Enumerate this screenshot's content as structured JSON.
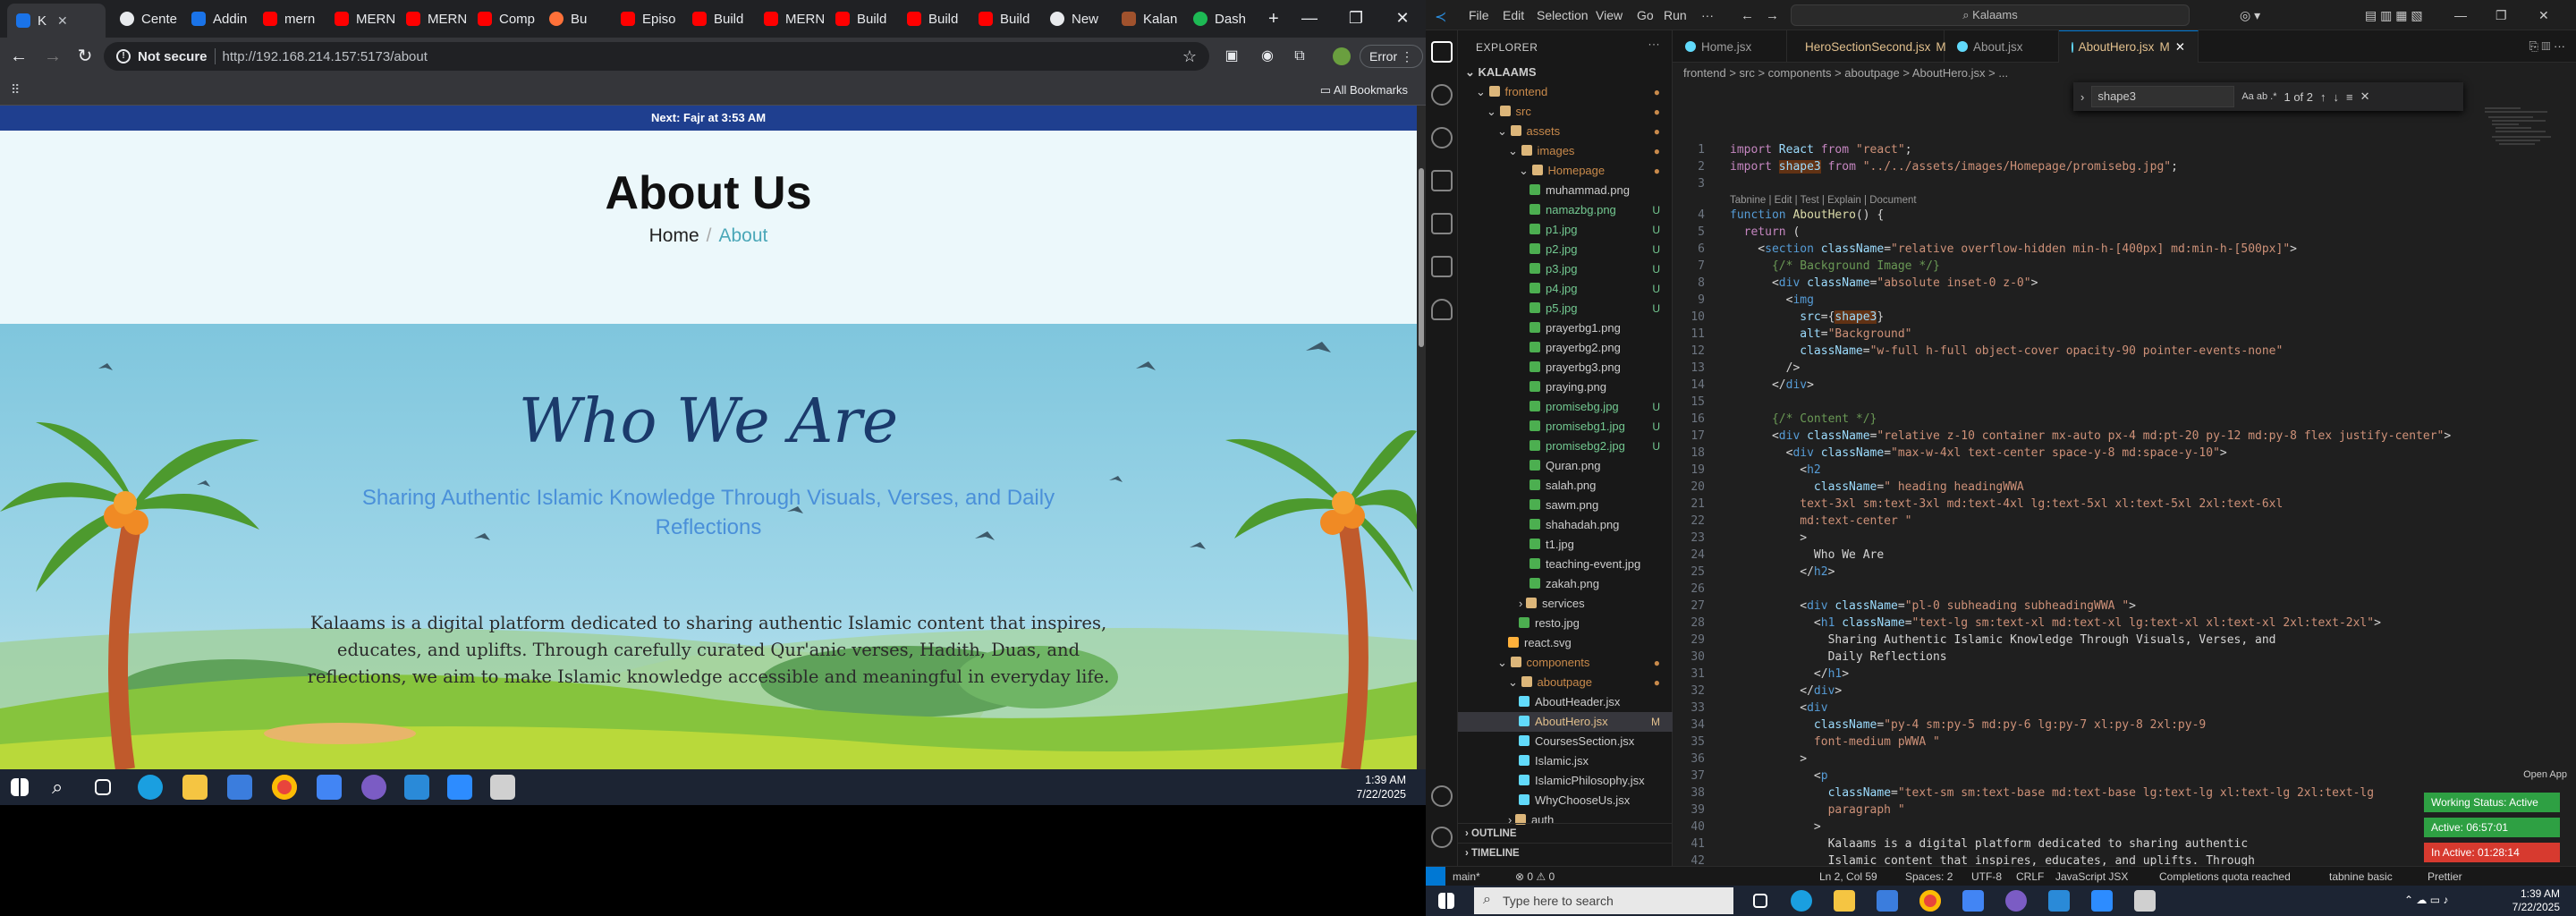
{
  "chrome": {
    "tabs": [
      {
        "label": "K",
        "fav": "fav-blue",
        "active": true
      },
      {
        "label": "Cente",
        "fav": "fav-gh"
      },
      {
        "label": "Addin",
        "fav": "fav-blue"
      },
      {
        "label": "mern",
        "fav": "fav-yt"
      },
      {
        "label": "MERN",
        "fav": "fav-yt"
      },
      {
        "label": "MERN",
        "fav": "fav-yt"
      },
      {
        "label": "Comp",
        "fav": "fav-yt"
      },
      {
        "label": "Bu",
        "fav": "fav-fox"
      },
      {
        "label": "Episo",
        "fav": "fav-yt"
      },
      {
        "label": "Build",
        "fav": "fav-yt"
      },
      {
        "label": "MERN",
        "fav": "fav-yt"
      },
      {
        "label": "Build",
        "fav": "fav-yt"
      },
      {
        "label": "Build",
        "fav": "fav-yt"
      },
      {
        "label": "Build",
        "fav": "fav-yt"
      },
      {
        "label": "New",
        "fav": "fav-gh"
      },
      {
        "label": "Kalan",
        "fav": "fav-brown"
      },
      {
        "label": "Dash",
        "fav": "fav-green"
      }
    ],
    "new_tab": "+",
    "not_secure": "Not secure",
    "url": "http://192.168.214.157:5173/about",
    "error": "Error",
    "all_bookmarks": "All Bookmarks"
  },
  "site": {
    "prayer_bar": "Next: Fajr at 3:53 AM",
    "about_title": "About Us",
    "crumb_home": "Home",
    "crumb_sep": "/",
    "crumb_current": "About",
    "who_title": "Who We Are",
    "who_subtitle": "Sharing Authentic Islamic Knowledge Through Visuals, Verses, and Daily Reflections",
    "who_paragraph": "Kalaams is a digital platform dedicated to sharing authentic Islamic content that inspires, educates, and uplifts. Through carefully curated Qur'anic verses, Hadith, Duas, and reflections, we aim to make Islamic knowledge accessible and meaningful in everyday life."
  },
  "inner_clock": {
    "time": "1:39 AM",
    "date": "7/22/2025"
  },
  "vscode": {
    "menu": [
      "File",
      "Edit",
      "Selection",
      "View",
      "Go",
      "Run"
    ],
    "search": "Kalaams",
    "explorer_label": "EXPLORER",
    "root": "KALAAMS",
    "tree": [
      {
        "name": "frontend",
        "type": "folder",
        "depth": 1,
        "badge": "●"
      },
      {
        "name": "src",
        "type": "folder",
        "depth": 2,
        "badge": "●"
      },
      {
        "name": "assets",
        "type": "folder",
        "depth": 3,
        "badge": "●"
      },
      {
        "name": "images",
        "type": "folder",
        "depth": 4,
        "badge": "●"
      },
      {
        "name": "Homepage",
        "type": "folder",
        "depth": 5,
        "badge": "●"
      },
      {
        "name": "muhammad.png",
        "type": "img",
        "depth": 6,
        "badge": ""
      },
      {
        "name": "namazbg.png",
        "type": "img",
        "depth": 6,
        "badge": "U"
      },
      {
        "name": "p1.jpg",
        "type": "img",
        "depth": 6,
        "badge": "U"
      },
      {
        "name": "p2.jpg",
        "type": "img",
        "depth": 6,
        "badge": "U"
      },
      {
        "name": "p3.jpg",
        "type": "img",
        "depth": 6,
        "badge": "U"
      },
      {
        "name": "p4.jpg",
        "type": "img",
        "depth": 6,
        "badge": "U"
      },
      {
        "name": "p5.jpg",
        "type": "img",
        "depth": 6,
        "badge": "U"
      },
      {
        "name": "prayerbg1.png",
        "type": "img",
        "depth": 6,
        "badge": ""
      },
      {
        "name": "prayerbg2.png",
        "type": "img",
        "depth": 6,
        "badge": ""
      },
      {
        "name": "prayerbg3.png",
        "type": "img",
        "depth": 6,
        "badge": ""
      },
      {
        "name": "praying.png",
        "type": "img",
        "depth": 6,
        "badge": ""
      },
      {
        "name": "promisebg.jpg",
        "type": "img",
        "depth": 6,
        "badge": "U"
      },
      {
        "name": "promisebg1.jpg",
        "type": "img",
        "depth": 6,
        "badge": "U"
      },
      {
        "name": "promisebg2.jpg",
        "type": "img",
        "depth": 6,
        "badge": "U"
      },
      {
        "name": "Quran.png",
        "type": "img",
        "depth": 6,
        "badge": ""
      },
      {
        "name": "salah.png",
        "type": "img",
        "depth": 6,
        "badge": ""
      },
      {
        "name": "sawm.png",
        "type": "img",
        "depth": 6,
        "badge": ""
      },
      {
        "name": "shahadah.png",
        "type": "img",
        "depth": 6,
        "badge": ""
      },
      {
        "name": "t1.jpg",
        "type": "img",
        "depth": 6,
        "badge": ""
      },
      {
        "name": "teaching-event.jpg",
        "type": "img",
        "depth": 6,
        "badge": ""
      },
      {
        "name": "zakah.png",
        "type": "img",
        "depth": 6,
        "badge": ""
      },
      {
        "name": "services",
        "type": "folder",
        "depth": 5,
        "badge": ""
      },
      {
        "name": "resto.jpg",
        "type": "img",
        "depth": 5,
        "badge": ""
      },
      {
        "name": "react.svg",
        "type": "svgf",
        "depth": 4,
        "badge": ""
      },
      {
        "name": "components",
        "type": "folder",
        "depth": 3,
        "badge": "●"
      },
      {
        "name": "aboutpage",
        "type": "folder",
        "depth": 4,
        "badge": "●"
      },
      {
        "name": "AboutHeader.jsx",
        "type": "jsx",
        "depth": 5,
        "badge": ""
      },
      {
        "name": "AboutHero.jsx",
        "type": "jsx",
        "depth": 5,
        "badge": "M",
        "sel": true
      },
      {
        "name": "CoursesSection.jsx",
        "type": "jsx",
        "depth": 5,
        "badge": ""
      },
      {
        "name": "Islamic.jsx",
        "type": "jsx",
        "depth": 5,
        "badge": ""
      },
      {
        "name": "IslamicPhilosophy.jsx",
        "type": "jsx",
        "depth": 5,
        "badge": ""
      },
      {
        "name": "WhyChooseUs.jsx",
        "type": "jsx",
        "depth": 5,
        "badge": ""
      },
      {
        "name": "auth",
        "type": "folder",
        "depth": 4,
        "badge": ""
      }
    ],
    "outline": "OUTLINE",
    "timeline": "TIMELINE",
    "editor_tabs": [
      {
        "label": "Home.jsx",
        "mod": ""
      },
      {
        "label": "HeroSectionSecond.jsx",
        "mod": "M"
      },
      {
        "label": "About.jsx",
        "mod": ""
      },
      {
        "label": "AboutHero.jsx",
        "mod": "M",
        "active": true
      }
    ],
    "breadcrumb": "frontend > src > components > aboutpage > AboutHero.jsx > ...",
    "find_value": "shape3",
    "find_count": "1 of 2",
    "tabnine_hint": "Tabnine | Edit | Test | Explain | Document",
    "status": {
      "branch": "main*",
      "problems": "⊗ 0 ⚠ 0",
      "position": "Ln 2, Col 59",
      "spaces": "Spaces: 2",
      "encoding": "UTF-8",
      "eol": "CRLF",
      "lang": "JavaScript JSX",
      "quota": "Completions quota reached",
      "tabnine": "tabnine basic",
      "prettier": "Prettier"
    },
    "open_app": "Open App",
    "working_status": "Working Status: Active",
    "active_time": "Active: 06:57:01",
    "inactive_time": "In Active: 01:28:14"
  },
  "taskbar": {
    "search_placeholder": "Type here to search",
    "time": "1:39 AM",
    "date": "7/22/2025"
  }
}
